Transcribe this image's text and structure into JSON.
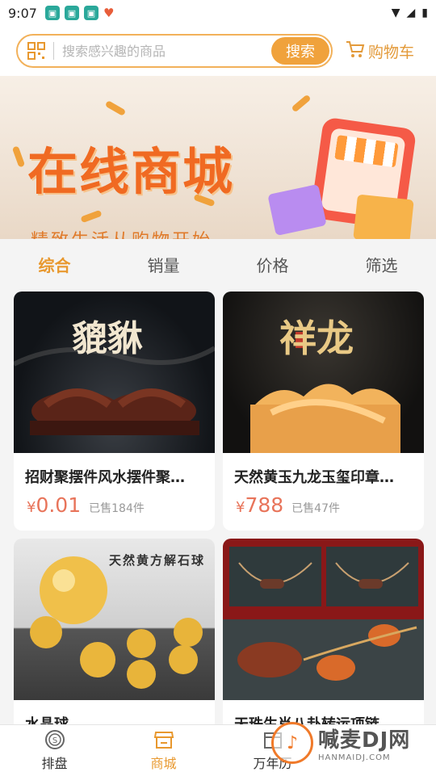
{
  "status_bar": {
    "time": "9:07"
  },
  "header": {
    "search_placeholder": "搜索感兴趣的商品",
    "search_button": "搜索",
    "cart_label": "购物车"
  },
  "banner": {
    "title": "在线商城",
    "subtitle": "精致生活从购物开始"
  },
  "sort_tabs": [
    {
      "label": "综合",
      "active": true
    },
    {
      "label": "销量",
      "active": false
    },
    {
      "label": "价格",
      "active": false
    },
    {
      "label": "筛选",
      "active": false
    }
  ],
  "products": [
    {
      "title": "招财聚摆件风水摆件聚…",
      "currency": "¥",
      "price": "0.01",
      "sold": "已售184件",
      "image_text": "貔貅"
    },
    {
      "title": "天然黄玉九龙玉玺印章…",
      "currency": "¥",
      "price": "788",
      "sold": "已售47件",
      "image_text": "祥龙"
    },
    {
      "title": "水晶球",
      "image_text": "天然黄方解石球"
    },
    {
      "title": "天珠生肖八卦转运项链"
    }
  ],
  "bottom_nav": [
    {
      "label": "排盘",
      "icon": "coin-icon",
      "active": false
    },
    {
      "label": "商城",
      "icon": "store-icon",
      "active": true
    },
    {
      "label": "万年历",
      "icon": "calendar-icon",
      "active": false
    }
  ],
  "watermark": {
    "text": "喊麦DJ网",
    "url_text": "HANMAIDJ.COM"
  },
  "colors": {
    "accent": "#e8982e",
    "price": "#e8745a",
    "banner_title": "#f06a22"
  }
}
